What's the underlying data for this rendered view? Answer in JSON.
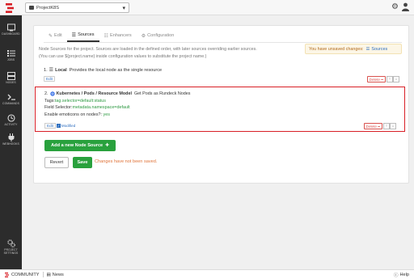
{
  "topbar": {
    "project": "ProjectK8S"
  },
  "sidebar": {
    "items": [
      {
        "label": "DASHBOARD",
        "icon": "dashboard-icon"
      },
      {
        "label": "JOBS",
        "icon": "jobs-icon"
      },
      {
        "label": "NODES",
        "icon": "nodes-icon"
      },
      {
        "label": "COMMANDS",
        "icon": "commands-icon"
      },
      {
        "label": "ACTIVITY",
        "icon": "activity-icon"
      },
      {
        "label": "WEBHOOKS",
        "icon": "webhooks-icon"
      }
    ],
    "settings_label_1": "PROJECT",
    "settings_label_2": "SETTINGS"
  },
  "tabs": [
    {
      "label": "Edit",
      "icon": "pencil-icon"
    },
    {
      "label": "Sources",
      "icon": "sources-icon"
    },
    {
      "label": "Enhancers",
      "icon": "enhancers-icon"
    },
    {
      "label": "Configuration",
      "icon": "gear-icon"
    }
  ],
  "description": {
    "line1": "Node Sources for the project. Sources are loaded in the defined order, with later sources overriding earlier sources.",
    "line2": "(You can use ${project.name} inside configuration values to substitute the project name.)"
  },
  "unsaved": {
    "text": "You have unsaved changes:",
    "link": "Sources"
  },
  "source1": {
    "number": "1.",
    "name": "Local",
    "desc": "Provides the local node as the single resource",
    "edit": "Edit",
    "delete": "Delete"
  },
  "source2": {
    "number": "2.",
    "name": "Kubernetes / Pods / Resource Model",
    "desc": "Get Pods as Rundeck Nodes",
    "tags_label": "Tags:",
    "tags_value": "tag.selector=default:status",
    "field_label": "Field Selector:",
    "field_value": "metadata.namespace=default",
    "emoticons_label": "Enable emoticons on nodes?:",
    "emoticons_value": "yes",
    "edit": "Edit",
    "modified": "Modified",
    "delete": "Delete"
  },
  "actions": {
    "add_node_source": "Add a new Node Source",
    "revert": "Revert",
    "save": "Save",
    "not_saved": "Changes have not been saved."
  },
  "footer": {
    "community": "COMMUNITY",
    "news": "News",
    "help": "Help"
  },
  "colors": {
    "brand_red": "#d81f26",
    "green": "#29a13d",
    "link_blue": "#2f6fbf",
    "sidebar_bg": "#2c2c2c"
  }
}
